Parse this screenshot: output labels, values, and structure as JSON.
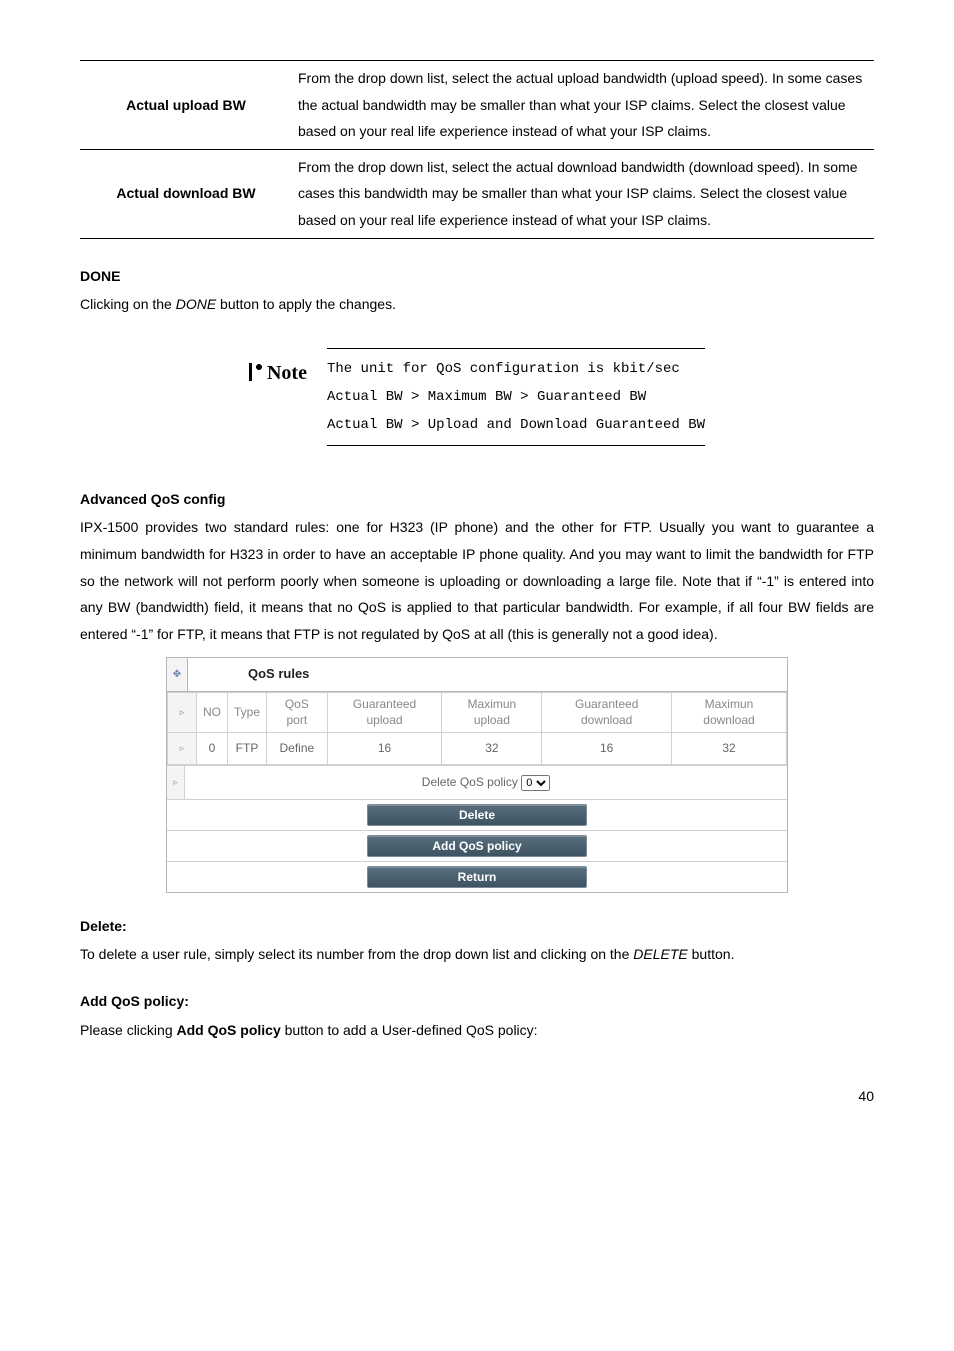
{
  "params": {
    "upload": {
      "label": "Actual upload BW",
      "desc": "From the drop down list, select the actual upload bandwidth (upload speed). In some cases the actual bandwidth may be smaller than what your ISP claims. Select the closest value based on your real life experience instead of what your ISP claims."
    },
    "download": {
      "label": "Actual download BW",
      "desc": "From the drop down list, select the actual download bandwidth (download speed). In some cases this bandwidth may be smaller than what your ISP claims. Select the closest value based on your real life experience instead of what your ISP claims."
    }
  },
  "done": {
    "heading": "DONE",
    "text_prefix": "Clicking on the ",
    "text_em": "DONE",
    "text_suffix": " button to apply the changes."
  },
  "note": {
    "label": "Note",
    "lines": "The unit for QoS configuration is kbit/sec\nActual BW > Maximum BW > Guaranteed BW\nActual BW > Upload and Download Guaranteed BW"
  },
  "adv": {
    "heading": "Advanced QoS config",
    "para": "IPX-1500 provides two standard rules: one for H323 (IP phone) and the other for FTP. Usually you want to guarantee a minimum bandwidth for H323 in order to have an acceptable IP phone quality. And you may want to limit the bandwidth for FTP so the network will not perform poorly when someone is uploading or downloading a large file. Note that if “-1” is entered into any BW (bandwidth) field, it means that no QoS is applied to that particular bandwidth. For example, if all four BW fields are entered “-1” for FTP, it means that FTP is not regulated by QoS at all (this is generally not a good idea)."
  },
  "qos": {
    "title": "QoS rules",
    "headers": {
      "no": "NO",
      "type": "Type",
      "port": "QoS port",
      "g_up": "Guaranteed upload",
      "m_up": "Maximun upload",
      "g_dn": "Guaranteed download",
      "m_dn": "Maximun download"
    },
    "row0": {
      "no": "0",
      "type": "FTP",
      "port": "Define",
      "g_up": "16",
      "m_up": "32",
      "g_dn": "16",
      "m_dn": "32"
    },
    "delete_label": "Delete QoS policy",
    "delete_option": "0",
    "buttons": {
      "delete": "Delete",
      "add": "Add QoS policy",
      "return": "Return"
    }
  },
  "delete": {
    "heading": "Delete:",
    "text_prefix": "To delete a user rule, simply select its number from the drop down list and clicking on the ",
    "text_em": "DELETE",
    "text_suffix": " button."
  },
  "add": {
    "heading": "Add QoS policy:",
    "text_prefix": "Please clicking ",
    "text_bold": "Add QoS policy",
    "text_suffix": " button to add a User-defined QoS policy:"
  },
  "page_number": "40"
}
